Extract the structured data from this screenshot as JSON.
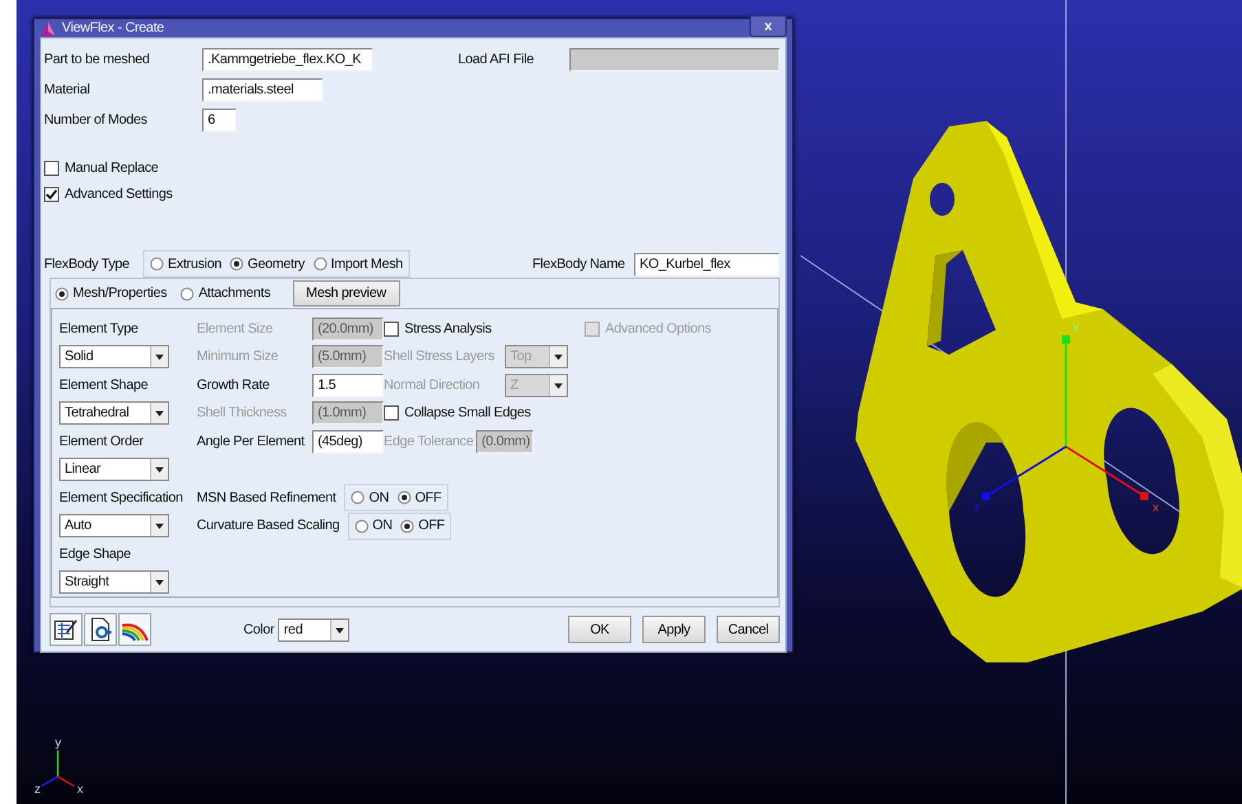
{
  "window": {
    "title": "ViewFlex - Create",
    "close": "x"
  },
  "part": {
    "label": "Part to be meshed",
    "value": ".Kammgetriebe_flex.KO_K"
  },
  "load_afi": {
    "label": "Load AFI File",
    "disabled": true
  },
  "material": {
    "label": "Material",
    "value": ".materials.steel"
  },
  "modes": {
    "label": "Number of Modes",
    "value": "6"
  },
  "options": [
    {
      "label": "Manual Replace",
      "checked": false
    },
    {
      "label": "Advanced Settings",
      "checked": true
    }
  ],
  "flexbody_type": {
    "label": "FlexBody Type",
    "options": [
      {
        "label": "Extrusion",
        "selected": false
      },
      {
        "label": "Geometry",
        "selected": true
      },
      {
        "label": "Import Mesh",
        "selected": false
      }
    ]
  },
  "flexbody_name": {
    "label": "FlexBody Name",
    "value": "KO_Kurbel_flex"
  },
  "tabs": [
    {
      "label": "Mesh/Properties",
      "selected": true
    },
    {
      "label": "Attachments",
      "selected": false
    }
  ],
  "mesh_preview": "Mesh preview",
  "element_settings": [
    {
      "label": "Element Type",
      "value": "Solid"
    },
    {
      "label": "Element Shape",
      "value": "Tetrahedral"
    },
    {
      "label": "Element Order",
      "value": "Linear"
    },
    {
      "label": "Element Specification",
      "value": "Auto"
    },
    {
      "label": "Edge Shape",
      "value": "Straight"
    }
  ],
  "mesh_parameters": [
    {
      "kind": "field",
      "label": "Element Size",
      "value": "(20.0mm)",
      "disabled": true
    },
    {
      "kind": "field",
      "label": "Minimum Size",
      "value": "(5.0mm)",
      "disabled": true
    },
    {
      "kind": "field",
      "label": "Growth Rate",
      "value": "1.5",
      "disabled": false
    },
    {
      "kind": "field",
      "label": "Shell Thickness",
      "value": "(1.0mm)",
      "disabled": true
    },
    {
      "kind": "field",
      "label": "Angle Per Element",
      "value": "(45deg)",
      "disabled": false
    },
    {
      "kind": "toggle",
      "label": "MSN Based Refinement",
      "options": [
        {
          "label": "ON",
          "selected": false
        },
        {
          "label": "OFF",
          "selected": true
        }
      ]
    },
    {
      "kind": "toggle",
      "label": "Curvature Based Scaling",
      "options": [
        {
          "label": "ON",
          "selected": false
        },
        {
          "label": "OFF",
          "selected": true
        }
      ]
    }
  ],
  "analysis_options": [
    {
      "kind": "checkbox",
      "label": "Stress Analysis",
      "checked": false,
      "disabled": false
    },
    {
      "kind": "dropdown",
      "label": "Shell Stress Layers",
      "value": "Top",
      "disabled": true
    },
    {
      "kind": "dropdown",
      "label": "Normal Direction",
      "value": "Z",
      "disabled": true
    },
    {
      "kind": "checkbox",
      "label": "Collapse Small Edges",
      "checked": false,
      "disabled": false
    },
    {
      "kind": "field",
      "label": "Edge Tolerance",
      "value": "(0.0mm)",
      "disabled": true
    }
  ],
  "advanced_options": {
    "label": "Advanced Options",
    "checked": false,
    "disabled": true
  },
  "color": {
    "label": "Color",
    "value": "red"
  },
  "buttons": [
    "OK",
    "Apply",
    "Cancel"
  ],
  "model_axes": [
    "y",
    "z",
    "x"
  ],
  "triad": [
    "y",
    "z",
    "x"
  ]
}
